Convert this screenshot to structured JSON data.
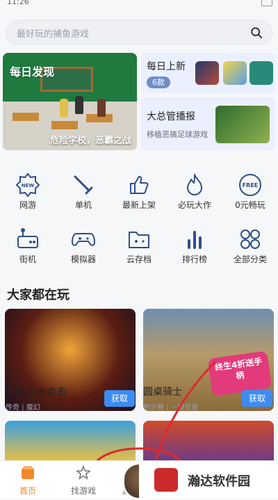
{
  "status": {
    "time": "11:26"
  },
  "search": {
    "placeholder": "最好玩的捕鱼游戏"
  },
  "featured": {
    "daily": {
      "title": "每日发现",
      "caption": "危险学校，恶霸之战"
    },
    "updates": {
      "title": "每日上新",
      "count": "6款"
    },
    "report": {
      "title": "大总管播报",
      "subtitle": "移植恶搞足球游戏"
    }
  },
  "categories": [
    {
      "label": "网游",
      "icon": "new-badge-icon"
    },
    {
      "label": "单机",
      "icon": "sword-icon"
    },
    {
      "label": "最新上架",
      "icon": "thumbs-up-icon"
    },
    {
      "label": "必玩大作",
      "icon": "flame-icon"
    },
    {
      "label": "0元畅玩",
      "icon": "free-badge-icon"
    },
    {
      "label": "街机",
      "icon": "arcade-icon"
    },
    {
      "label": "模拟器",
      "icon": "gamepad-icon"
    },
    {
      "label": "云存档",
      "icon": "cloud-folder-icon"
    },
    {
      "label": "排行榜",
      "icon": "bar-chart-icon"
    },
    {
      "label": "全部分类",
      "icon": "grid-icon"
    }
  ],
  "section": {
    "title": "大家都在玩"
  },
  "games": [
    {
      "name": "1.85打金合击",
      "tags": "传奇 | 魔幻",
      "button": "获取"
    },
    {
      "name": "圆桌骑士",
      "tags": "积分赛 | 一键技能",
      "button": "获取",
      "promo": "终生4折送手柄"
    }
  ],
  "tabs": [
    {
      "label": "首页",
      "active": true
    },
    {
      "label": "找游戏",
      "active": false
    },
    {
      "label": "启动",
      "active": false
    }
  ],
  "watermark": {
    "text": "瀚达软件园"
  },
  "colors": {
    "accent": "#3d8cf2",
    "tab_active": "#f08a2b",
    "icon_blue": "#2f4f86"
  }
}
